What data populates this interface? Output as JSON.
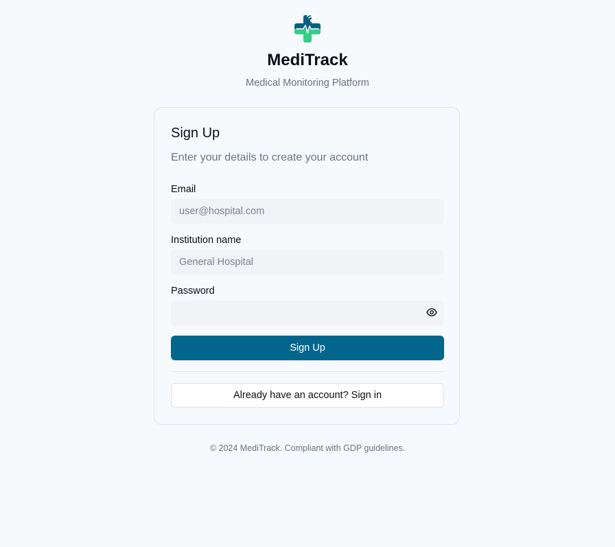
{
  "brand": {
    "name": "MediTrack",
    "subtitle": "Medical Monitoring Platform",
    "logo_icon": "medical-cross-heartbeat-icon",
    "colors": {
      "logo_top": "#0b5f86",
      "logo_bottom": "#34cf85",
      "accent": "#02658c"
    }
  },
  "form": {
    "title": "Sign Up",
    "description": "Enter your details to create your account",
    "email": {
      "label": "Email",
      "placeholder": "user@hospital.com",
      "value": ""
    },
    "institution": {
      "label": "Institution name",
      "placeholder": "General Hospital",
      "value": ""
    },
    "password": {
      "label": "Password",
      "placeholder": "",
      "value": "",
      "toggle_icon": "eye-icon"
    },
    "submit_label": "Sign Up",
    "signin_label": "Already have an account? Sign in"
  },
  "footer": {
    "text": "© 2024 MediTrack. Compliant with GDP guidelines."
  }
}
